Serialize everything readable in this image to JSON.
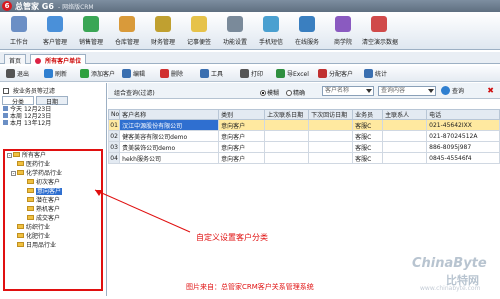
{
  "window": {
    "logo": "6",
    "title": "总管家 G6",
    "subtitle": "- 网络版CRM"
  },
  "toolbar": [
    {
      "label": "工作台",
      "icon": "desk-icon",
      "color": "#6b8fc5"
    },
    {
      "label": "客户管理",
      "icon": "customers-icon",
      "color": "#4a90d9"
    },
    {
      "label": "销售管理",
      "icon": "sales-icon",
      "color": "#3aa655"
    },
    {
      "label": "仓库管理",
      "icon": "warehouse-icon",
      "color": "#d99a3a"
    },
    {
      "label": "财务管理",
      "icon": "finance-icon",
      "color": "#c0a030"
    },
    {
      "label": "记事便签",
      "icon": "notes-icon",
      "color": "#e6c24a"
    },
    {
      "label": "功能设置",
      "icon": "settings-icon",
      "color": "#7a8a9a"
    },
    {
      "label": "手机短信",
      "icon": "sms-icon",
      "color": "#4aa0d0"
    },
    {
      "label": "在线服务",
      "icon": "service-icon",
      "color": "#3a7fc0"
    },
    {
      "label": "商学院",
      "icon": "academy-icon",
      "color": "#8a5ac0"
    },
    {
      "label": "清空演示数据",
      "icon": "clear-icon",
      "color": "#d04a4a"
    }
  ],
  "tabs": [
    {
      "label": "首页"
    },
    {
      "label": "所有客户单位"
    }
  ],
  "actions": [
    {
      "label": "退出",
      "icon": "exit-icon",
      "color": "#555"
    },
    {
      "label": "刷新",
      "icon": "refresh-icon",
      "color": "#2f7fd0"
    },
    {
      "label": "添加客户",
      "icon": "add-icon",
      "color": "#2fa040"
    },
    {
      "label": "编辑",
      "icon": "edit-icon",
      "color": "#3a6fb0"
    },
    {
      "label": "删除",
      "icon": "delete-icon",
      "color": "#d03030"
    },
    {
      "label": "工具",
      "icon": "tools-icon",
      "color": "#3a6fb0"
    },
    {
      "label": "打印",
      "icon": "print-icon",
      "color": "#555"
    },
    {
      "label": "导Excel",
      "icon": "excel-icon",
      "color": "#2f8f3f"
    },
    {
      "label": "分配客户",
      "icon": "assign-icon",
      "color": "#c03030"
    },
    {
      "label": "统计",
      "icon": "stats-icon",
      "color": "#3a6fb0"
    }
  ],
  "left": {
    "checkbox_label": "按业务员等过滤",
    "tabs": [
      "分类",
      "日期"
    ],
    "dates": [
      {
        "label": "今天",
        "date": "12月23日"
      },
      {
        "label": "本周",
        "date": "12月23日"
      },
      {
        "label": "本月",
        "date": "13年12月"
      }
    ],
    "tree": [
      {
        "label": "所有客户",
        "level": 0
      },
      {
        "label": "医药行业",
        "level": 1
      },
      {
        "label": "化学药品行业",
        "level": 1
      },
      {
        "label": "初次客户",
        "level": 2
      },
      {
        "label": "意向客户",
        "level": 2
      },
      {
        "label": "潜在客户",
        "level": 2
      },
      {
        "label": "熟机客户",
        "level": 2
      },
      {
        "label": "成交客户",
        "level": 2
      },
      {
        "label": "纺织行业",
        "level": 1
      },
      {
        "label": "化肥行业",
        "level": 1
      },
      {
        "label": "日用品行业",
        "level": 1
      }
    ]
  },
  "search": {
    "title": "组合查询(过滤)",
    "radio_fuzzy": "模糊",
    "radio_exact": "精确",
    "field_placeholder": "客户名称",
    "value_placeholder": "查询内容",
    "query_label": "查询",
    "clear_label": "✖"
  },
  "grid": {
    "columns": [
      "No",
      "客户名称",
      "类别",
      "上次联系日期",
      "下次回访日期",
      "业务员",
      "主联系人",
      "电话"
    ],
    "rows": [
      {
        "no": "01",
        "name": "汉江中源股份有限公司",
        "category": "意向客户",
        "last": "",
        "next": "",
        "rep": "客服C",
        "contact": "",
        "phone": "021-45642IXX"
      },
      {
        "no": "02",
        "name": "健客美容有限公司demo",
        "category": "意向客户",
        "last": "",
        "next": "",
        "rep": "客服C",
        "contact": "",
        "phone": "021-87024512A"
      },
      {
        "no": "03",
        "name": "贵美装饰公司demo",
        "category": "意向客户",
        "last": "",
        "next": "",
        "rep": "客服C",
        "contact": "",
        "phone": "886-8095j987"
      },
      {
        "no": "04",
        "name": "hekh服务公司",
        "category": "意向客户",
        "last": "",
        "next": "",
        "rep": "客服C",
        "contact": "",
        "phone": "0845-45546f4"
      }
    ]
  },
  "annotation": "自定义设置客户分类",
  "source_note": "图片来自：总管家CRM客户关系管理系统",
  "watermark": {
    "line1": "ChinaByte",
    "line2": "比特网",
    "line3": "www.chinabyte.com"
  },
  "colors": {
    "highlight": "#2f6fd0",
    "annotation": "#e01010",
    "selected_row": "#ffe9a0"
  }
}
